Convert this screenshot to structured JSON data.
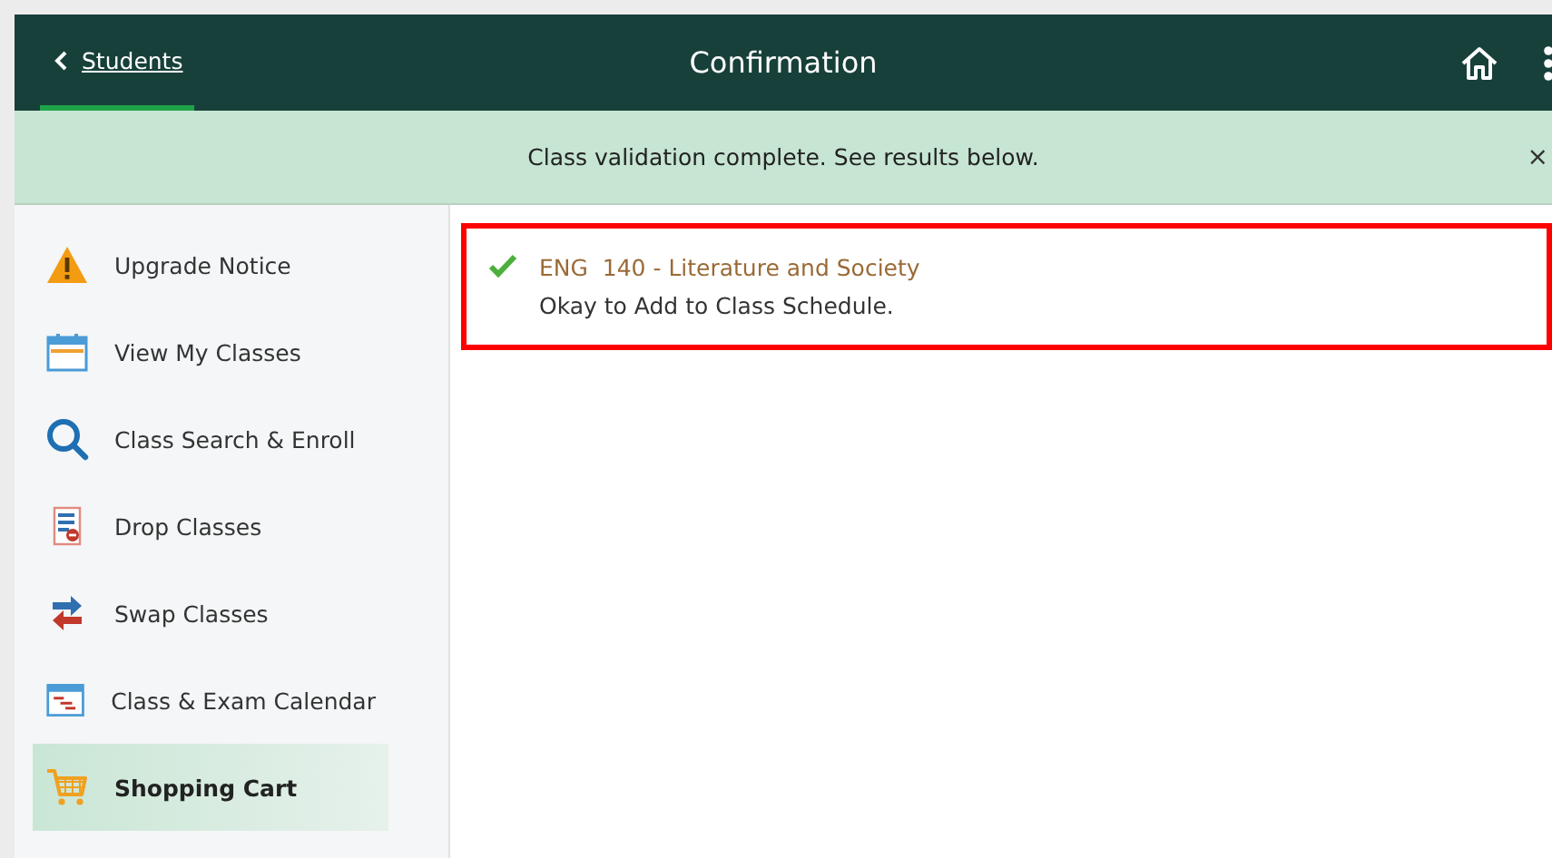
{
  "header": {
    "back_link": "Students",
    "title": "Confirmation"
  },
  "banner": {
    "message": "Class validation complete. See results below.",
    "close": "×"
  },
  "sidebar": {
    "items": [
      {
        "label": "Upgrade Notice",
        "kind": "warning",
        "selected": false
      },
      {
        "label": "View My Classes",
        "kind": "calendar",
        "selected": false
      },
      {
        "label": "Class Search & Enroll",
        "kind": "search",
        "selected": false
      },
      {
        "label": "Drop Classes",
        "kind": "drop",
        "selected": false
      },
      {
        "label": "Swap Classes",
        "kind": "swap",
        "selected": false
      },
      {
        "label": "Class & Exam Calendar",
        "kind": "schedule",
        "selected": false
      },
      {
        "label": "Shopping Cart",
        "kind": "cart",
        "selected": true
      }
    ]
  },
  "results": [
    {
      "course": "ENG  140 - Literature and Society",
      "message": "Okay to Add to Class Schedule.",
      "passed": true,
      "highlighted": true
    }
  ]
}
